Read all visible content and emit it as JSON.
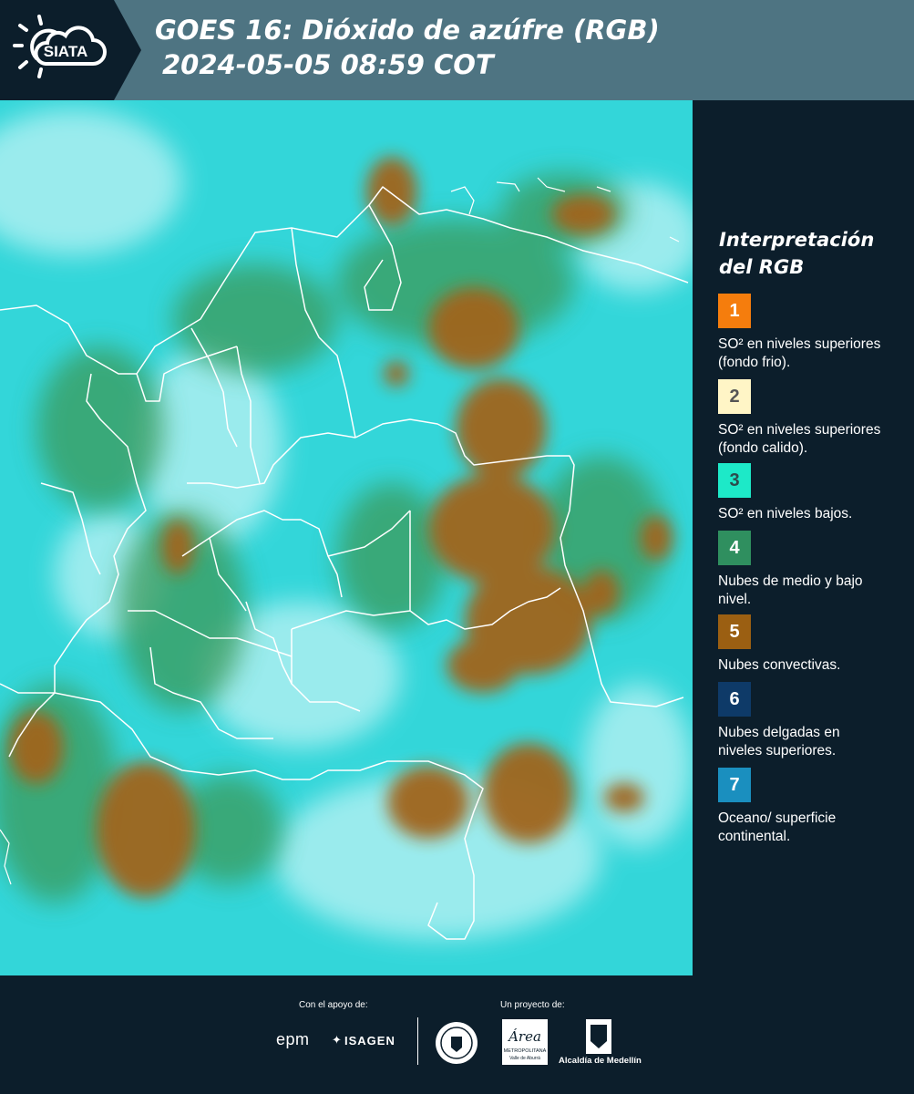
{
  "header": {
    "logo_text": "SIATA",
    "title_line1": "GOES 16: Dióxido de azúfre (RGB)",
    "title_line2": "2024-05-05 08:59 COT"
  },
  "legend": {
    "title": "Interpretación del RGB",
    "items": [
      {
        "number": "1",
        "color": "#f57d0d",
        "text_color": "#ffffff",
        "label": "SO² en niveles superiores (fondo frio)."
      },
      {
        "number": "2",
        "color": "#fff5c6",
        "text_color": "#555555",
        "label": "SO² en niveles superiores (fondo calido)."
      },
      {
        "number": "3",
        "color": "#1de9c8",
        "text_color": "#2c4c4c",
        "label": "SO² en niveles bajos."
      },
      {
        "number": "4",
        "color": "#2f8f5f",
        "text_color": "#ffffff",
        "label": "Nubes de medio y bajo nivel."
      },
      {
        "number": "5",
        "color": "#9b5f12",
        "text_color": "#ffffff",
        "label": "Nubes convectivas."
      },
      {
        "number": "6",
        "color": "#0e3a68",
        "text_color": "#ffffff",
        "label": "Nubes delgadas en niveles superiores."
      },
      {
        "number": "7",
        "color": "#1a8fbf",
        "text_color": "#ffffff",
        "label": "Oceano/ superficie continental."
      }
    ]
  },
  "footer": {
    "support_label": "Con el apoyo de:",
    "project_label": "Un proyecto de:",
    "sponsor1": "epm",
    "sponsor2": "ISAGEN",
    "partner1_line1": "Área",
    "partner1_line2": "METROPOLITANA",
    "partner1_line3": "Valle de Aburrá",
    "partner2": "Alcaldía de Medellín"
  }
}
